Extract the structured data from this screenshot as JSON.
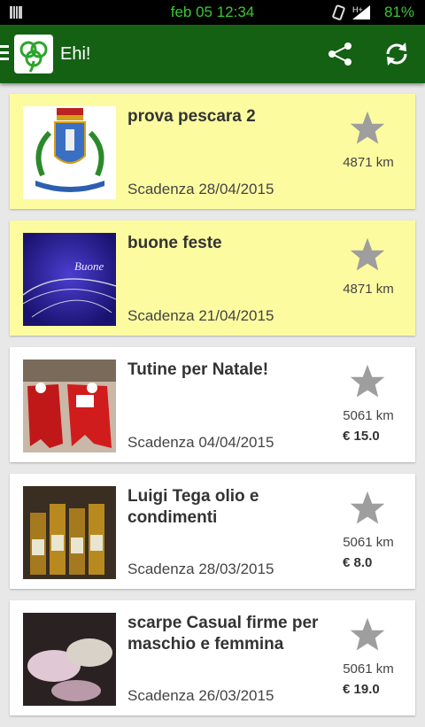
{
  "status_bar": {
    "time": "feb 05 12:34",
    "battery": "81%"
  },
  "app_bar": {
    "title": "Ehi!"
  },
  "items": [
    {
      "title": "prova pescara 2",
      "expiry": "Scadenza 28/04/2015",
      "distance": "4871 km",
      "price": "",
      "featured": true,
      "thumb": "coat-of-arms"
    },
    {
      "title": "buone feste",
      "expiry": "Scadenza 21/04/2015",
      "distance": "4871 km",
      "price": "",
      "featured": true,
      "thumb": "buone-feste-card"
    },
    {
      "title": "Tutine per Natale!",
      "expiry": "Scadenza 04/04/2015",
      "distance": "5061 km",
      "price": "€ 15.0",
      "featured": false,
      "thumb": "red-baby-suits"
    },
    {
      "title": "Luigi Tega olio e condimenti",
      "expiry": "Scadenza 28/03/2015",
      "distance": "5061 km",
      "price": "€ 8.0",
      "featured": false,
      "thumb": "oil-bottles"
    },
    {
      "title": "scarpe Casual firme per maschio e femmina",
      "expiry": "Scadenza 26/03/2015",
      "distance": "5061 km",
      "price": "€ 19.0",
      "featured": false,
      "thumb": "shoes"
    }
  ],
  "colors": {
    "app_bar": "#146114",
    "featured_card": "#fdfba0",
    "status_text": "#36c936",
    "star": "#9e9e9e"
  }
}
